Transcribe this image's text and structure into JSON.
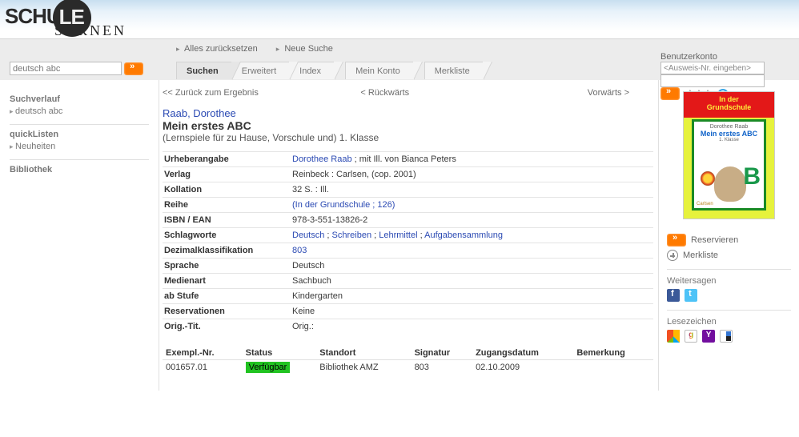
{
  "logo": {
    "word1": "SCHU",
    "word2": "LE",
    "sub": "SARNEN"
  },
  "topbar": {
    "reset": "Alles zurücksetzen",
    "newsearch": "Neue Suche",
    "account_label": "Benutzerkonto",
    "account_placeholder": "<Ausweis-Nr. eingeben>",
    "aaa": "A A A"
  },
  "search": {
    "value": "deutsch abc"
  },
  "tabs": [
    "Suchen",
    "Erweitert",
    "Index",
    "Mein Konto",
    "Merkliste"
  ],
  "left": {
    "verlauf_h": "Suchverlauf",
    "verlauf_item": "deutsch abc",
    "quick_h": "quickListen",
    "quick_item": "Neuheiten",
    "bib_h": "Bibliothek"
  },
  "nav": {
    "back": "<< Zurück zum Ergebnis",
    "prev": "< Rückwärts",
    "next": "Vorwärts >"
  },
  "record": {
    "author": "Raab, Dorothee",
    "title": "Mein erstes ABC",
    "subtitle": "(Lernspiele für zu Hause, Vorschule und) 1. Klasse",
    "rows": [
      {
        "label": "Urheberangabe",
        "type": "mixed",
        "parts": [
          {
            "t": "Dorothee Raab",
            "link": true
          },
          {
            "t": " ; mit Ill. von Bianca Peters",
            "link": false
          }
        ]
      },
      {
        "label": "Verlag",
        "type": "text",
        "value": "Reinbeck : Carlsen, (cop. 2001)"
      },
      {
        "label": "Kollation",
        "type": "text",
        "value": "32 S. : Ill."
      },
      {
        "label": "Reihe",
        "type": "link",
        "value": "(In der Grundschule ; 126)"
      },
      {
        "label": "ISBN / EAN",
        "type": "text",
        "value": "978-3-551-13826-2"
      },
      {
        "label": "Schlagworte",
        "type": "tags",
        "tags": [
          "Deutsch",
          "Schreiben",
          "Lehrmittel",
          "Aufgabensammlung"
        ]
      },
      {
        "label": "Dezimalklassifikation",
        "type": "link",
        "value": "803"
      },
      {
        "label": "Sprache",
        "type": "text",
        "value": "Deutsch"
      },
      {
        "label": "Medienart",
        "type": "text",
        "value": "Sachbuch"
      },
      {
        "label": "ab Stufe",
        "type": "text",
        "value": "Kindergarten"
      },
      {
        "label": "Reservationen",
        "type": "text",
        "value": "Keine"
      },
      {
        "label": "Orig.-Tit.",
        "type": "text",
        "value": "Orig.:"
      }
    ]
  },
  "copies": {
    "headers": [
      "Exempl.-Nr.",
      "Status",
      "Standort",
      "Signatur",
      "Zugangsdatum",
      "Bemerkung"
    ],
    "rows": [
      {
        "nr": "001657.01",
        "status": "Verfügbar",
        "standort": "Bibliothek AMZ",
        "signatur": "803",
        "datum": "02.10.2009",
        "bem": ""
      }
    ]
  },
  "rightcol": {
    "cover": {
      "strip": "In der\nGrundschule",
      "small": "Dorothee Raab",
      "title": "Mein erstes ABC",
      "grade": "1. Klasse",
      "letter": "B",
      "pub": "Carlsen"
    },
    "reserve": "Reservieren",
    "merk": "Merkliste",
    "share_h": "Weitersagen",
    "book_h": "Lesezeichen"
  }
}
